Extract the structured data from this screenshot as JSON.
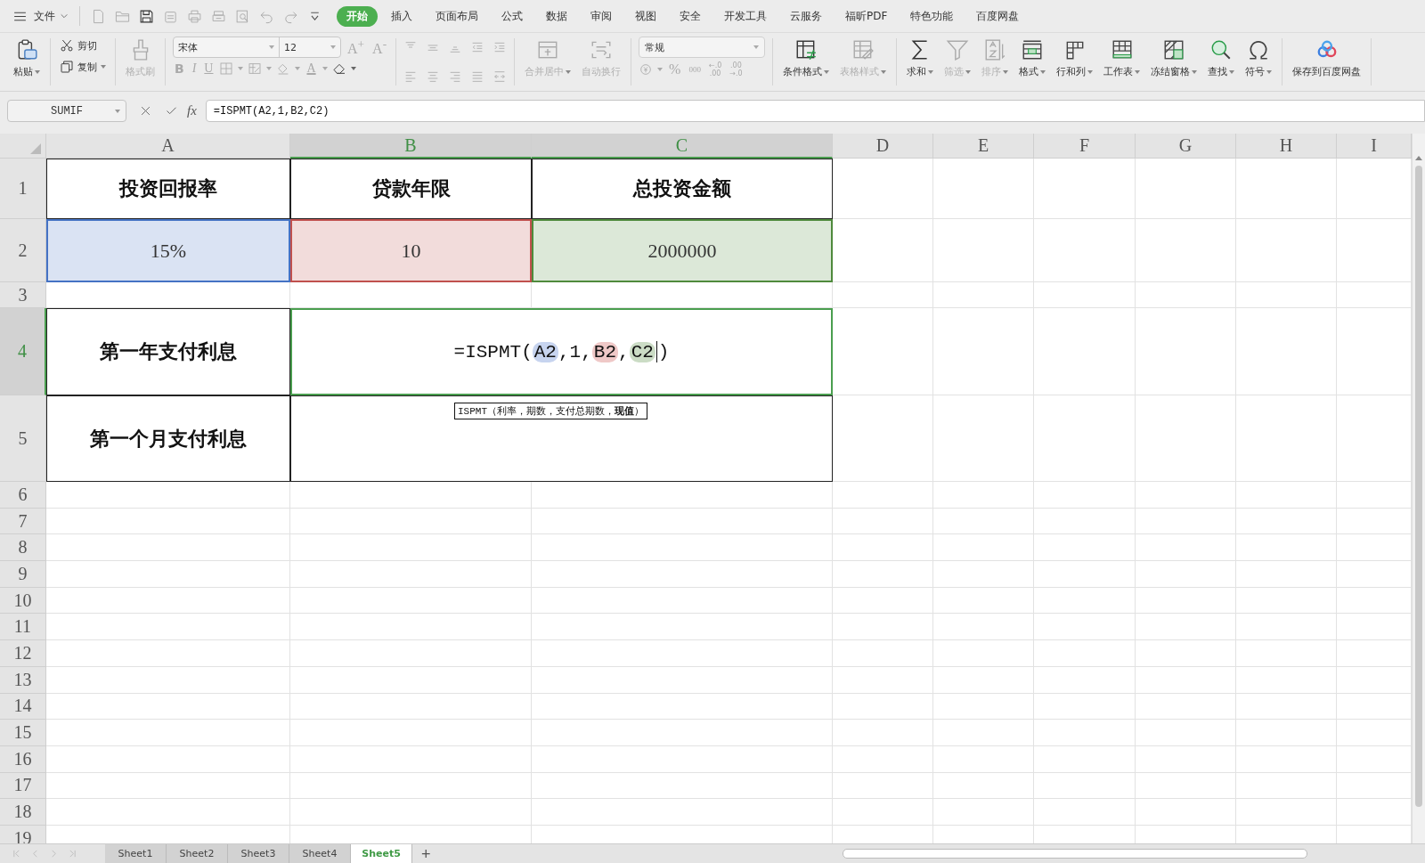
{
  "menu": {
    "file_label": "文件",
    "tabs": [
      {
        "label": "开始",
        "selected": true
      },
      {
        "label": "插入",
        "selected": false
      },
      {
        "label": "页面布局",
        "selected": false
      },
      {
        "label": "公式",
        "selected": false
      },
      {
        "label": "数据",
        "selected": false
      },
      {
        "label": "审阅",
        "selected": false
      },
      {
        "label": "视图",
        "selected": false
      },
      {
        "label": "安全",
        "selected": false
      },
      {
        "label": "开发工具",
        "selected": false
      },
      {
        "label": "云服务",
        "selected": false
      },
      {
        "label": "福昕PDF",
        "selected": false
      },
      {
        "label": "特色功能",
        "selected": false
      },
      {
        "label": "百度网盘",
        "selected": false
      }
    ]
  },
  "ribbon": [
    {
      "kind": "large",
      "items": [
        {
          "label": "粘贴",
          "dropdown": true,
          "disabled": false
        }
      ]
    },
    {
      "kind": "small",
      "items": [
        {
          "label": "剪切",
          "dropdown": false,
          "disabled": false
        },
        {
          "label": "复制",
          "dropdown": true,
          "disabled": false
        }
      ]
    },
    {
      "kind": "large",
      "items": [
        {
          "label": "格式刷",
          "dropdown": false,
          "disabled": true
        }
      ]
    },
    {
      "kind": "font",
      "font_name": "宋体",
      "font_size": "12",
      "size_buttons": [
        "A$^{+}$",
        "A$^{-}$"
      ],
      "style_buttons": [
        "B",
        "I",
        "U"
      ],
      "color_button": "A"
    },
    {
      "kind": "align"
    },
    {
      "kind": "large",
      "items": [
        {
          "label": "合并居中",
          "dropdown": true,
          "disabled": true
        },
        {
          "label": "自动换行",
          "dropdown": false,
          "disabled": true
        }
      ]
    },
    {
      "kind": "number",
      "format": "常规",
      "percent": "%",
      "thousands": "000",
      "decimal_buttons": [
        {
          "top": "←.0",
          "bottom": ".00"
        },
        {
          "top": ".00",
          "bottom": "→.0"
        }
      ]
    },
    {
      "kind": "large",
      "items": [
        {
          "label": "条件格式",
          "dropdown": true,
          "disabled": false
        },
        {
          "label": "表格样式",
          "dropdown": true,
          "disabled": true
        }
      ]
    },
    {
      "kind": "large",
      "items": [
        {
          "label": "求和",
          "dropdown": true,
          "disabled": false
        },
        {
          "label": "筛选",
          "dropdown": true,
          "disabled": true
        },
        {
          "label": "排序",
          "dropdown": true,
          "disabled": true
        },
        {
          "label": "格式",
          "dropdown": true,
          "disabled": false
        },
        {
          "label": "行和列",
          "dropdown": true,
          "disabled": false
        },
        {
          "label": "工作表",
          "dropdown": true,
          "disabled": false
        },
        {
          "label": "冻结窗格",
          "dropdown": true,
          "disabled": false
        },
        {
          "label": "查找",
          "dropdown": true,
          "disabled": false
        },
        {
          "label": "符号",
          "dropdown": true,
          "disabled": false
        }
      ]
    },
    {
      "kind": "large",
      "items": [
        {
          "label": "保存到百度网盘",
          "dropdown": false,
          "disabled": false
        }
      ]
    }
  ],
  "formula_bar": {
    "name_box": "SUMIF",
    "fx": "fx",
    "formula": "=ISPMT(A2,1,B2,C2)"
  },
  "sheet": {
    "columns": [
      {
        "label": "A",
        "selected": false
      },
      {
        "label": "B",
        "selected": true
      },
      {
        "label": "C",
        "selected": true
      },
      {
        "label": "D",
        "selected": false
      },
      {
        "label": "E",
        "selected": false
      },
      {
        "label": "F",
        "selected": false
      },
      {
        "label": "G",
        "selected": false
      },
      {
        "label": "H",
        "selected": false
      },
      {
        "label": "I",
        "selected": false
      }
    ],
    "rows": [
      {
        "label": "1",
        "selected": false,
        "cells": [
          {
            "kind": "header",
            "text": "投资回报率"
          },
          {
            "kind": "header",
            "text": "贷款年限"
          },
          {
            "kind": "header",
            "text": "总投资金额"
          }
        ]
      },
      {
        "label": "2",
        "selected": false,
        "cells": [
          {
            "kind": "value",
            "text": "15%",
            "color": "#4472c4"
          },
          {
            "kind": "value",
            "text": "10",
            "color": "#c0504d"
          },
          {
            "kind": "value",
            "text": "2000000",
            "color": "#4f8a3c"
          }
        ]
      },
      {
        "label": "3",
        "selected": false
      },
      {
        "label": "4",
        "selected": true,
        "cells": [
          {
            "kind": "header",
            "text": "第一年支付利息"
          },
          {
            "kind": "editor",
            "parts": [
              {
                "kind": "plain",
                "text": "=ISPMT("
              },
              {
                "kind": "ref",
                "text": "A2",
                "color": "#c7d4ef"
              },
              {
                "kind": "plain",
                "text": ",1,"
              },
              {
                "kind": "ref",
                "text": "B2",
                "color": "#efc8c7"
              },
              {
                "kind": "plain",
                "text": ","
              },
              {
                "kind": "ref",
                "text": "C2",
                "color": "#cbdcc5"
              },
              {
                "kind": "caret"
              },
              {
                "kind": "plain",
                "text": ")"
              }
            ],
            "tooltip": "ISPMT（利率，期数，支付总期数，**现值**）"
          }
        ]
      },
      {
        "label": "5",
        "selected": false,
        "cells": [
          {
            "kind": "header",
            "text": "第一个月支付利息"
          },
          {
            "kind": "merged"
          }
        ]
      },
      {
        "label": "6",
        "selected": false
      },
      {
        "label": "7",
        "selected": false
      },
      {
        "label": "8",
        "selected": false
      },
      {
        "label": "9",
        "selected": false
      },
      {
        "label": "10",
        "selected": false
      },
      {
        "label": "11",
        "selected": false
      },
      {
        "label": "12",
        "selected": false
      },
      {
        "label": "13",
        "selected": false
      },
      {
        "label": "14",
        "selected": false
      },
      {
        "label": "15",
        "selected": false
      },
      {
        "label": "16",
        "selected": false
      },
      {
        "label": "17",
        "selected": false
      },
      {
        "label": "18",
        "selected": false
      },
      {
        "label": "19",
        "selected": false
      }
    ]
  },
  "sheet_tabs": {
    "tabs": [
      {
        "label": "Sheet1",
        "selected": false
      },
      {
        "label": "Sheet2",
        "selected": false
      },
      {
        "label": "Sheet3",
        "selected": false
      },
      {
        "label": "Sheet4",
        "selected": false
      },
      {
        "label": "Sheet5",
        "selected": true
      }
    ],
    "add_button": "+"
  }
}
